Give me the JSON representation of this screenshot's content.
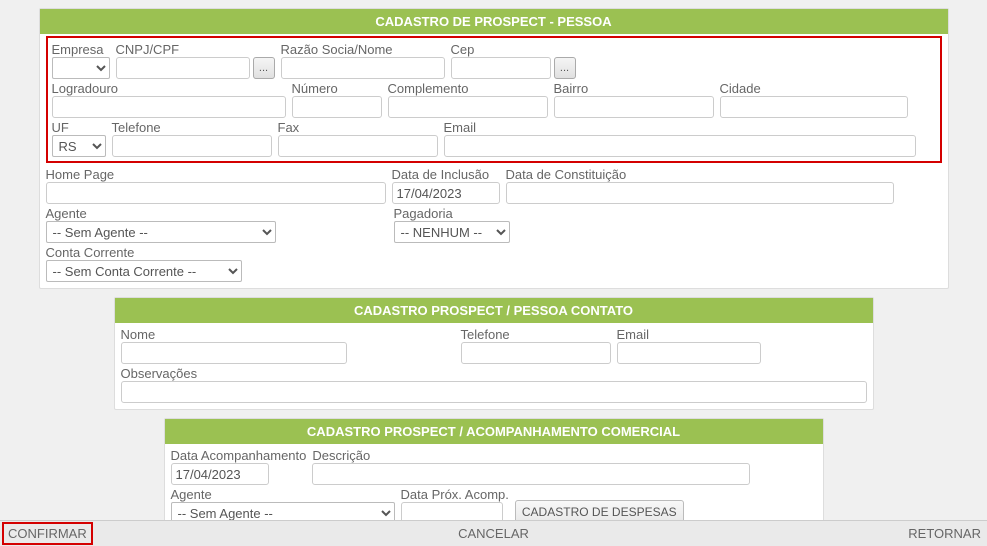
{
  "header_main": "CADASTRO DE PROSPECT - PESSOA",
  "header_contato": "CADASTRO PROSPECT / PESSOA CONTATO",
  "header_acomp": "CADASTRO PROSPECT / ACOMPANHAMENTO COMERCIAL",
  "labels": {
    "empresa": "Empresa",
    "cnpj": "CNPJ/CPF",
    "razao": "Razão Socia/Nome",
    "cep": "Cep",
    "logradouro": "Logradouro",
    "numero": "Número",
    "complemento": "Complemento",
    "bairro": "Bairro",
    "cidade": "Cidade",
    "uf": "UF",
    "telefone": "Telefone",
    "fax": "Fax",
    "email": "Email",
    "homepage": "Home Page",
    "data_inclusao": "Data de Inclusão",
    "data_const": "Data de Constituição",
    "agente": "Agente",
    "pagadoria": "Pagadoria",
    "conta": "Conta Corrente",
    "nome": "Nome",
    "observacoes": "Observações",
    "data_acomp": "Data Acompanhamento",
    "descricao": "Descrição",
    "data_prox": "Data Próx. Acomp."
  },
  "values": {
    "empresa": "",
    "cnpj": "",
    "razao": "",
    "cep": "",
    "logradouro": "",
    "numero": "",
    "complemento": "",
    "bairro": "",
    "cidade": "",
    "uf": "RS",
    "telefone": "",
    "fax": "",
    "email": "",
    "homepage": "",
    "data_inclusao": "17/04/2023",
    "data_const": "",
    "agente": "-- Sem Agente --",
    "pagadoria": "-- NENHUM --",
    "conta": "-- Sem Conta Corrente --",
    "c_nome": "",
    "c_tel": "",
    "c_email": "",
    "c_obs": "",
    "a_data": "17/04/2023",
    "a_desc": "",
    "a_agente": "-- Sem Agente --",
    "a_prox": ""
  },
  "buttons": {
    "lookup": "...",
    "despesas": "CADASTRO DE DESPESAS",
    "confirmar": "CONFIRMAR",
    "cancelar": "CANCELAR",
    "retornar": "RETORNAR"
  }
}
